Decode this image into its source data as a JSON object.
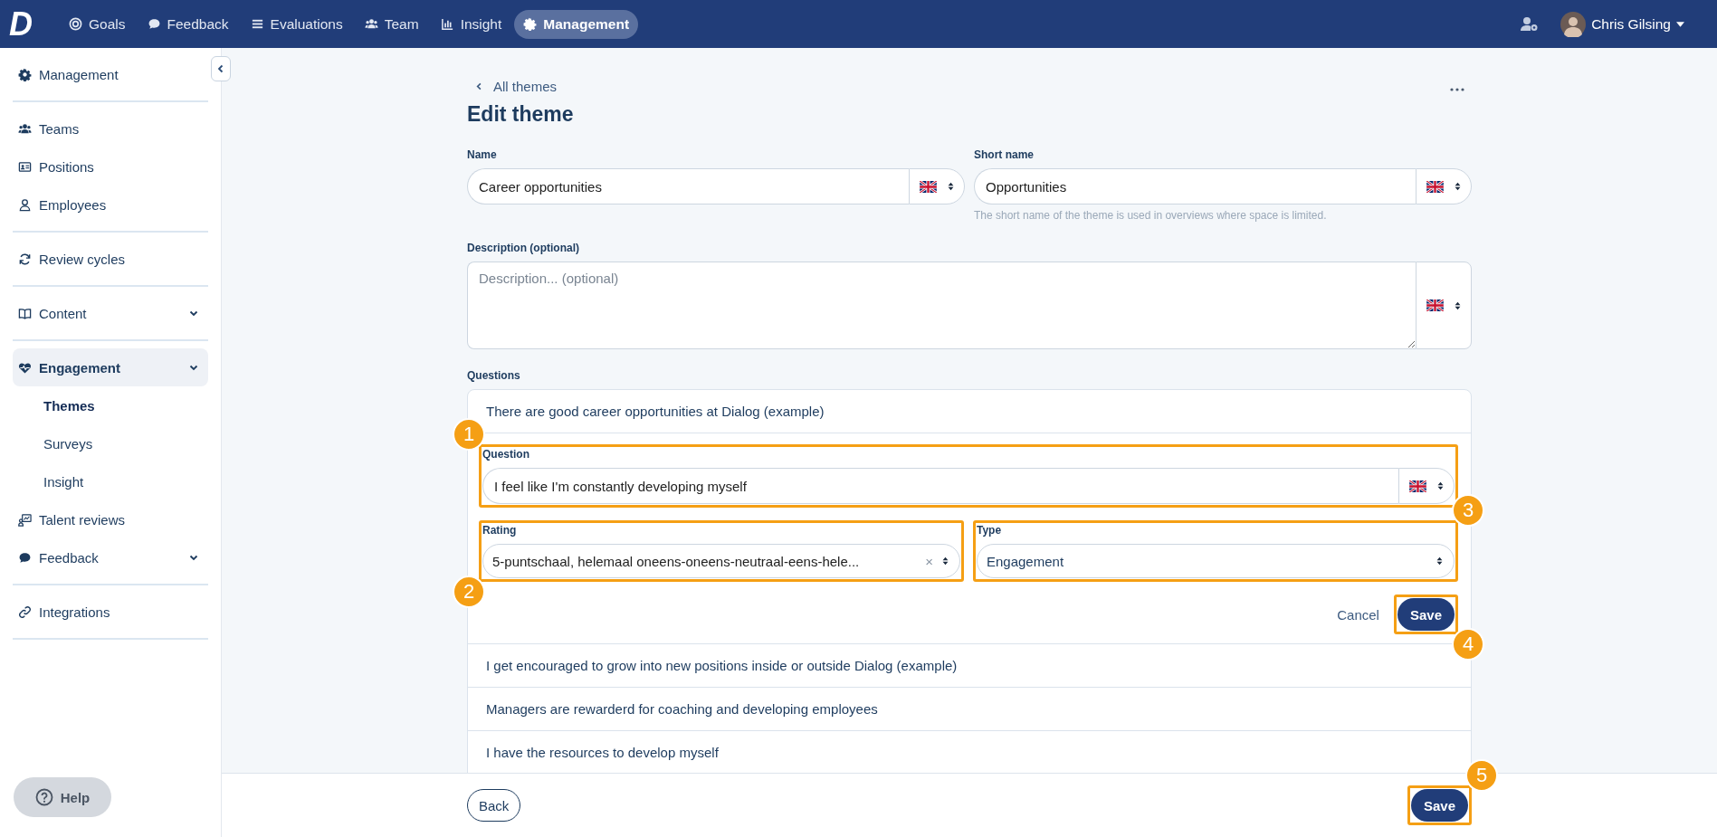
{
  "top_nav": {
    "logo": "D",
    "items": [
      {
        "label": "Goals",
        "selected": false
      },
      {
        "label": "Feedback",
        "selected": false
      },
      {
        "label": "Evaluations",
        "selected": false
      },
      {
        "label": "Team",
        "selected": false
      },
      {
        "label": "Insight",
        "selected": false
      },
      {
        "label": "Management",
        "selected": true
      }
    ],
    "user": {
      "name": "Chris Gilsing"
    }
  },
  "sidebar": {
    "groups": [
      [
        {
          "label": "Management",
          "selected": false
        }
      ],
      [
        {
          "label": "Teams",
          "selected": false
        },
        {
          "label": "Positions",
          "selected": false
        },
        {
          "label": "Employees",
          "selected": false
        }
      ],
      [
        {
          "label": "Review cycles",
          "selected": false
        }
      ],
      [
        {
          "label": "Content",
          "selected": false,
          "kind": "submenu"
        }
      ],
      [
        {
          "label": "Engagement",
          "selected": true,
          "kind": "submenu",
          "expanded": true,
          "children": [
            {
              "label": "Themes",
              "selected": true
            },
            {
              "label": "Surveys",
              "selected": false
            },
            {
              "label": "Insight",
              "selected": false
            }
          ]
        },
        {
          "label": "Talent reviews",
          "selected": false
        },
        {
          "label": "Feedback",
          "selected": false,
          "kind": "submenu"
        }
      ],
      [
        {
          "label": "Integrations",
          "selected": false
        }
      ]
    ],
    "help": "Help"
  },
  "back_link": "All themes",
  "title": "Edit theme",
  "name_field": {
    "label": "Name",
    "value": "Career opportunities"
  },
  "short_name_field": {
    "label": "Short name",
    "value": "Opportunities",
    "hint": "The short name of the theme is used in overviews where space is limited."
  },
  "description_field": {
    "label": "Description (optional)",
    "placeholder": "Description... (optional)"
  },
  "questions": {
    "label": "Questions",
    "items": [
      {
        "text": "There are good career opportunities at Dialog (example)",
        "expanded": false
      },
      {
        "text": "I feel like I'm constantly developing myself",
        "expanded": true
      },
      {
        "text": "I get encouraged to grow into new positions inside or outside Dialog (example)",
        "expanded": false
      },
      {
        "text": "Managers are rewarderd for coaching and developing employees",
        "expanded": false
      },
      {
        "text": "I have the resources to develop myself",
        "expanded": false
      }
    ],
    "editor": {
      "question_label": "Question",
      "question_callout": "1",
      "rating_label": "Rating",
      "rating_callout": "2",
      "rating_value": "5-puntschaal, helemaal oneens-oneens-neutraal-eens-hele...",
      "clear": "×",
      "type_label": "Type",
      "type_callout": "3",
      "type_value": "Engagement",
      "cancel": "Cancel",
      "save": "Save",
      "save_callout": "4"
    }
  },
  "footer": {
    "back": "Back",
    "save": "Save",
    "save_callout": "5"
  }
}
